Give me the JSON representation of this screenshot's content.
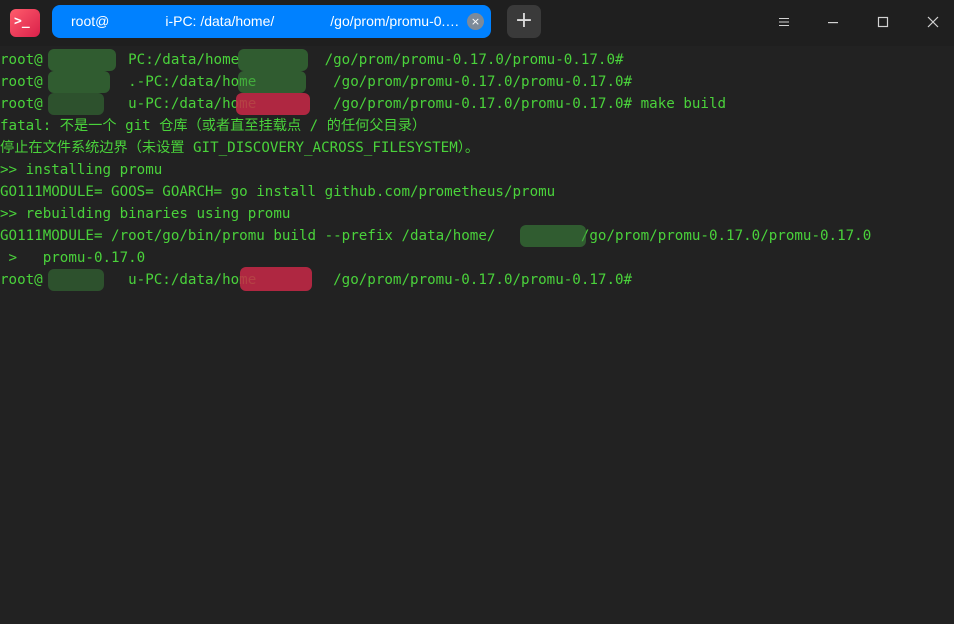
{
  "titlebar": {
    "app_icon_glyph": ">_",
    "tab_label": "root@    i-PC: /data/home/    /go/prom/promu-0.…",
    "tab_close_glyph": "×",
    "add_tab_glyph": "+"
  },
  "terminal": {
    "lines": [
      "root@          PC:/data/home          /go/prom/promu-0.17.0/promu-0.17.0#",
      "root@          .-PC:/data/home         /go/prom/promu-0.17.0/promu-0.17.0#",
      "root@          u-PC:/data/home         /go/prom/promu-0.17.0/promu-0.17.0# make build",
      "fatal: 不是一个 git 仓库（或者直至挂载点 / 的任何父目录）",
      "停止在文件系统边界（未设置 GIT_DISCOVERY_ACROSS_FILESYSTEM）。",
      ">> installing promu",
      "GO111MODULE= GOOS= GOARCH= go install github.com/prometheus/promu",
      ">> rebuilding binaries using promu",
      "GO111MODULE= /root/go/bin/promu build --prefix /data/home/          /go/prom/promu-0.17.0/promu-0.17.0",
      " >   promu-0.17.0",
      "root@          u-PC:/data/home         /go/prom/promu-0.17.0/promu-0.17.0#"
    ]
  },
  "colors": {
    "terminal_text": "#4ad23b",
    "background": "#222222",
    "tab_active": "#0081ff"
  }
}
